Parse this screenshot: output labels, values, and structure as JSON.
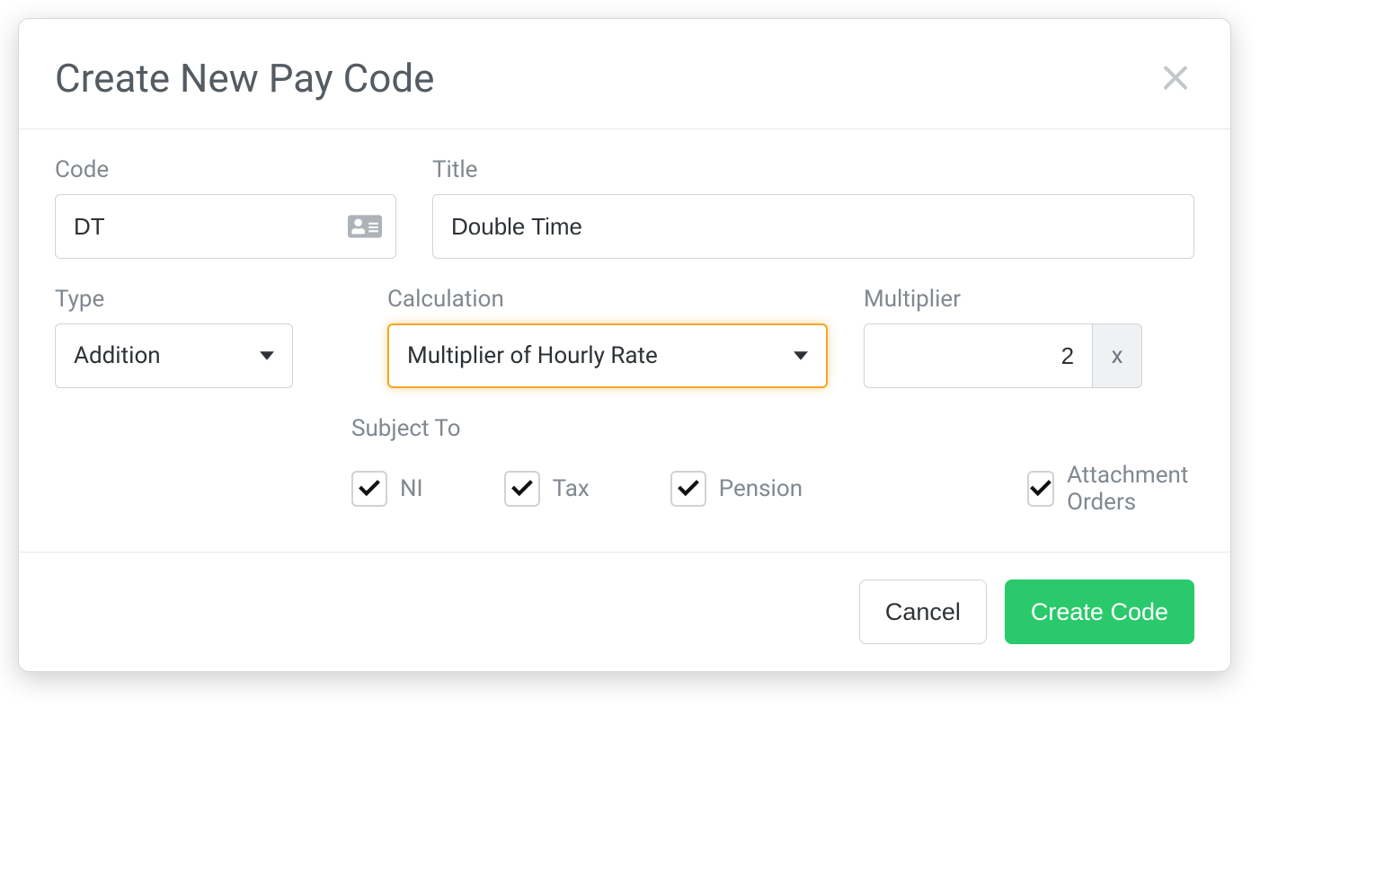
{
  "header": {
    "title": "Create New Pay Code"
  },
  "form": {
    "code": {
      "label": "Code",
      "value": "DT"
    },
    "title": {
      "label": "Title",
      "value": "Double Time"
    },
    "type": {
      "label": "Type",
      "selected": "Addition"
    },
    "calculation": {
      "label": "Calculation",
      "selected": "Multiplier of Hourly Rate"
    },
    "multiplier": {
      "label": "Multiplier",
      "value": "2",
      "suffix": "x"
    },
    "subjectTo": {
      "label": "Subject To",
      "options": {
        "ni": {
          "label": "NI",
          "checked": true
        },
        "tax": {
          "label": "Tax",
          "checked": true
        },
        "pension": {
          "label": "Pension",
          "checked": true
        },
        "attachment": {
          "label": "Attachment Orders",
          "checked": true
        }
      }
    }
  },
  "footer": {
    "cancel": "Cancel",
    "create": "Create Code"
  }
}
